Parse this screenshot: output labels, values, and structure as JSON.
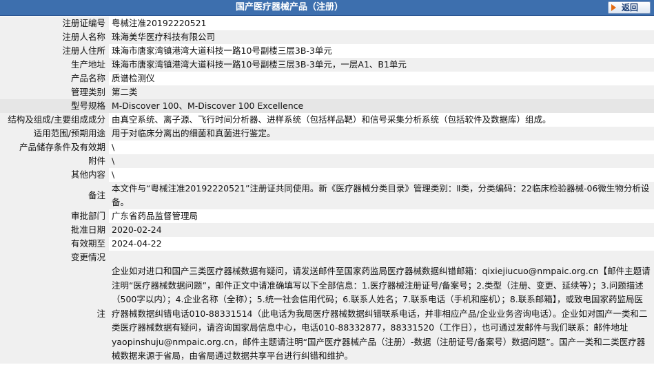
{
  "header": {
    "title": "国产医疗器械产品（注册）",
    "back_label": "返回"
  },
  "rows": [
    {
      "label": "注册证编号",
      "value": "粤械注准20192220521"
    },
    {
      "label": "注册人名称",
      "value": "珠海美华医疗科技有限公司"
    },
    {
      "label": "注册人住所",
      "value": "珠海市唐家湾镇港湾大道科技一路10号副楼三层3B-3单元"
    },
    {
      "label": "生产地址",
      "value": "珠海市唐家湾镇港湾大道科技一路10号副楼三层3B-3单元，一层A1、B1单元"
    },
    {
      "label": "产品名称",
      "value": "质谱检测仪"
    },
    {
      "label": "管理类别",
      "value": "第二类"
    },
    {
      "label": "型号规格",
      "value": "M-Discover 100、M-Discover 100 Excellence"
    },
    {
      "label": "结构及组成/主要组成成分",
      "value": "由真空系统、离子源、飞行时间分析器、进样系统（包括样品靶）和信号采集分析系统（包括软件及数据库）组成。"
    },
    {
      "label": "适用范围/预期用途",
      "value": "用于对临床分离出的细菌和真菌进行鉴定。"
    },
    {
      "label": "产品储存条件及有效期",
      "value": "\\"
    },
    {
      "label": "附件",
      "value": "\\"
    },
    {
      "label": "其他内容",
      "value": "\\"
    },
    {
      "label": "备注",
      "value": "本文件与“粤械注准20192220521”注册证共同使用。新《医疗器械分类目录》管理类别：Ⅱ类，分类编码：22临床检验器械-06微生物分析设备。"
    },
    {
      "label": "审批部门",
      "value": "广东省药品监督管理局"
    },
    {
      "label": "批准日期",
      "value": "2020-02-24"
    },
    {
      "label": "有效期至",
      "value": "2024-04-22"
    },
    {
      "label": "变更情况",
      "value": ""
    }
  ],
  "note": {
    "label": "注",
    "text": "企业如对进口和国产三类医疗器械数据有疑问，请发送邮件至国家药监局医疗器械数据纠错邮箱：qixiejiucuo@nmpaic.org.cn【邮件主题请注明“医疗器械数据问题”，邮件正文中请准确填写以下全部信息：1.医疗器械注册证号/备案号；2.类型（注册、变更、延续等）；3.问题描述（500字以内）；4.企业名称（全称）；5.统一社会信用代码；6.联系人姓名；7.联系电话（手机和座机）；8.联系邮箱】，或致电国家药监局医疗器械数据纠错电话010-88331514（此电话为我局医疗器械数据纠错联系电话，并非相应产品/企业业务咨询电话）。企业如对国产一类和二类医疗器械数据有疑问，请咨询国家局信息中心，电话010-88332877，88331520（工作日），也可通过发邮件与我们联系：邮件地址yaopinshuju@nmpaic.org.cn，邮件主题请注明“国产医疗器械产品（注册）-数据（注册证号/备案号）数据问题”。国产一类和二类医疗器械数据来源于省局，由省局通过数据共享平台进行纠错和维护。"
  }
}
